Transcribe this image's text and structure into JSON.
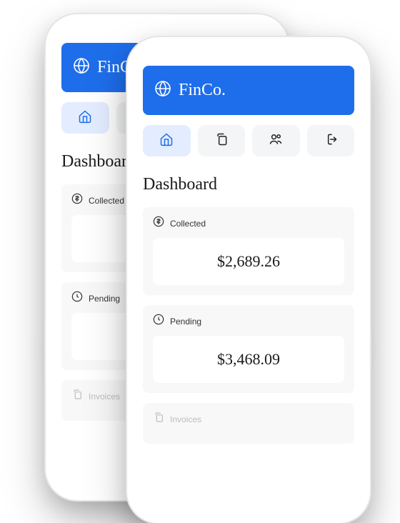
{
  "brand": "FinCo.",
  "section_title": "Dashboard",
  "cards": {
    "collected": {
      "label": "Collected",
      "value": "$2,689.26"
    },
    "pending": {
      "label": "Pending",
      "value": "$3,468.09"
    },
    "invoices": {
      "label": "Invoices"
    }
  },
  "colors": {
    "primary": "#1e6eeb",
    "active_bg": "#e3edff"
  }
}
